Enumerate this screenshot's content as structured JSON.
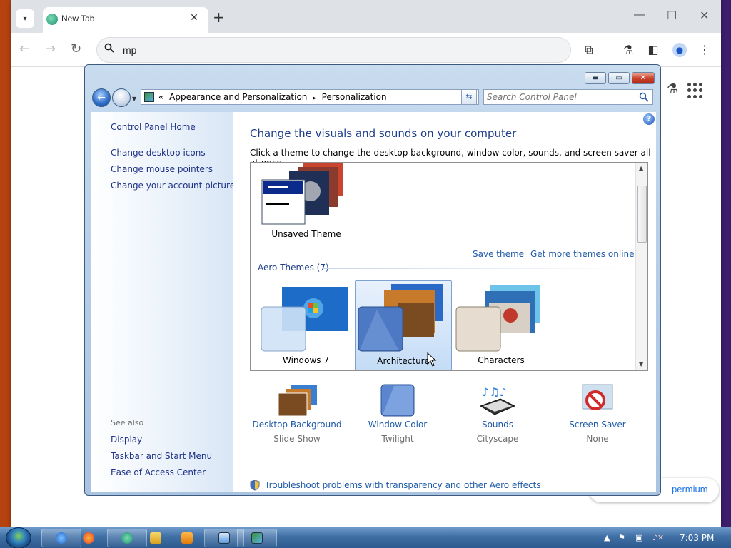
{
  "browser": {
    "tab_title": "New Tab",
    "omnibox_value": "mp",
    "premium_text": "permium"
  },
  "cp": {
    "breadcrumb": [
      "«",
      "Appearance and Personalization",
      "▸",
      "Personalization"
    ],
    "search_placeholder": "Search Control Panel",
    "left_links": [
      "Control Panel Home",
      "Change desktop icons",
      "Change mouse pointers",
      "Change your account picture"
    ],
    "see_also_label": "See also",
    "see_also_links": [
      "Display",
      "Taskbar and Start Menu",
      "Ease of Access Center"
    ],
    "main_title": "Change the visuals and sounds on your computer",
    "main_subtitle": "Click a theme to change the desktop background, window color, sounds, and screen saver all at once.",
    "unsaved_theme_label": "Unsaved Theme",
    "save_theme_link": "Save theme",
    "more_themes_link": "Get more themes online",
    "aero_group_label": "Aero Themes (7)",
    "themes": [
      {
        "label": "Windows 7",
        "selected": false
      },
      {
        "label": "Architecture",
        "selected": true
      },
      {
        "label": "Characters",
        "selected": false
      }
    ],
    "bottom_items": [
      {
        "title": "Desktop Background",
        "subtitle": "Slide Show",
        "icon": "desktop-background-icon"
      },
      {
        "title": "Window Color",
        "subtitle": "Twilight",
        "icon": "window-color-icon"
      },
      {
        "title": "Sounds",
        "subtitle": "Cityscape",
        "icon": "sounds-icon"
      },
      {
        "title": "Screen Saver",
        "subtitle": "None",
        "icon": "screen-saver-icon"
      }
    ],
    "troubleshoot_link": "Troubleshoot problems with transparency and other Aero effects"
  },
  "taskbar": {
    "clock": "7:03 PM",
    "apps": [
      "internet-explorer",
      "firefox",
      "edge-dev",
      "file-explorer",
      "media-player",
      "remote-desktop",
      "control-panel"
    ]
  },
  "colors": {
    "link": "#1e5aa8",
    "title_blue": "#1e3f8a",
    "left_link": "#1e3287"
  }
}
